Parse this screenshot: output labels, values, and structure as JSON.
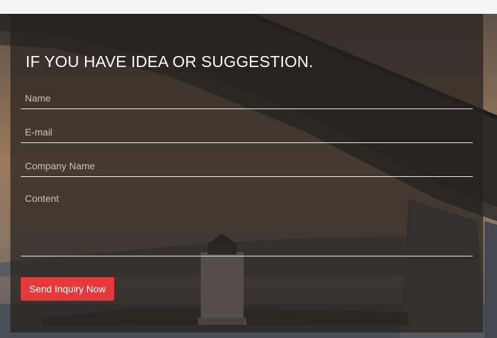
{
  "form": {
    "title": "IF YOU HAVE IDEA OR SUGGESTION.",
    "fields": {
      "name_placeholder": "Name",
      "email_placeholder": "E-mail",
      "company_placeholder": "Company Name",
      "content_placeholder": "Content"
    },
    "submit_label": "Send Inquiry Now"
  },
  "colors": {
    "submit_button": "#e5393c",
    "overlay": "rgba(38,33,29,0.72)",
    "text": "#ffffff"
  }
}
